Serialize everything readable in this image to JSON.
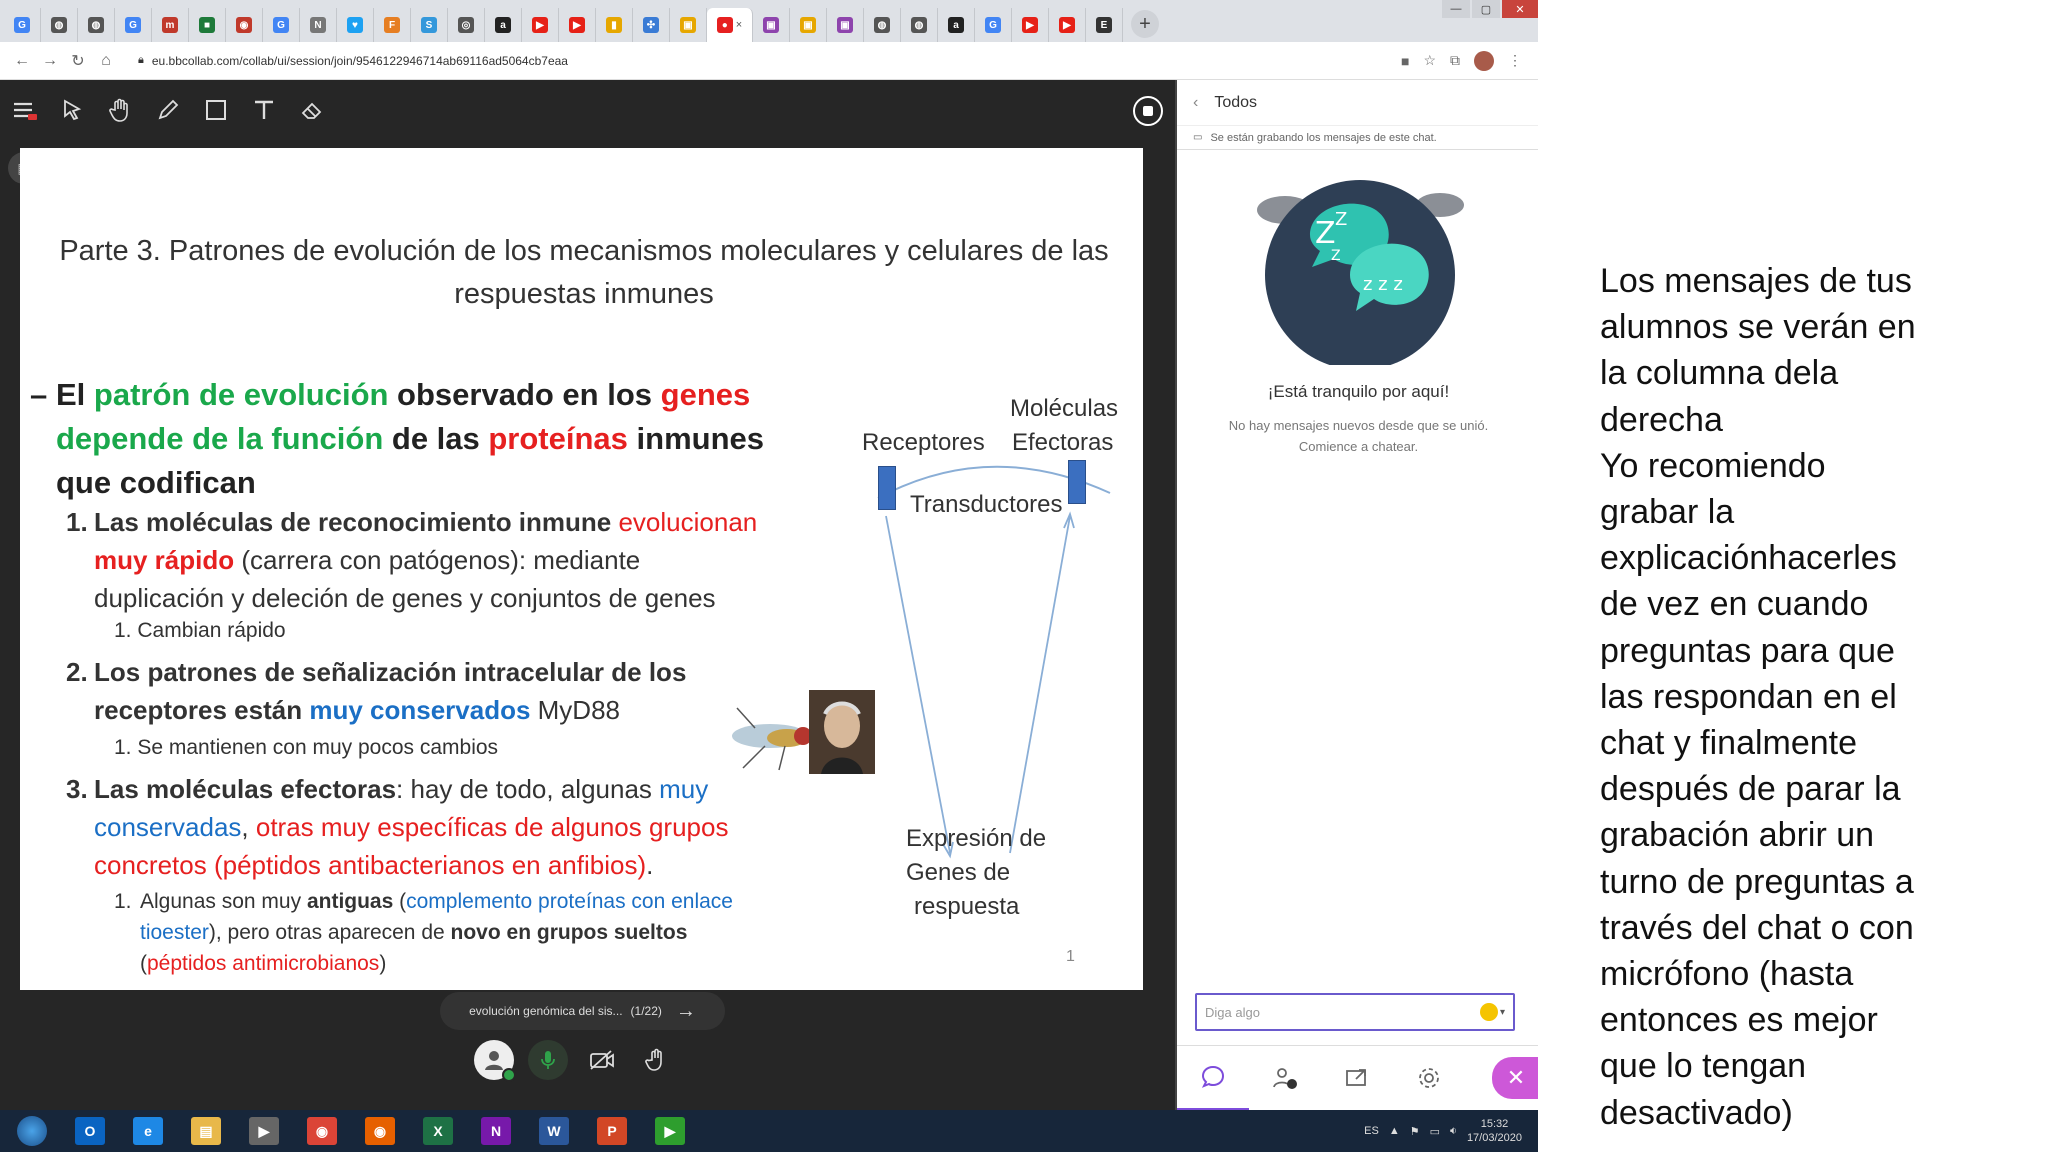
{
  "browser": {
    "tabs": [
      {
        "icon": "G",
        "color": "#4285f4"
      },
      {
        "icon": "◍",
        "color": "#555"
      },
      {
        "icon": "◍",
        "color": "#555"
      },
      {
        "icon": "G",
        "color": "#4285f4"
      },
      {
        "icon": "m",
        "color": "#c0392b"
      },
      {
        "icon": "■",
        "color": "#1e7a3a"
      },
      {
        "icon": "◉",
        "color": "#c0392b"
      },
      {
        "icon": "G",
        "color": "#4285f4"
      },
      {
        "icon": "N",
        "color": "#777"
      },
      {
        "icon": "♥",
        "color": "#1da1f2"
      },
      {
        "icon": "F",
        "color": "#e67e22"
      },
      {
        "icon": "S",
        "color": "#3498db"
      },
      {
        "icon": "◎",
        "color": "#555"
      },
      {
        "icon": "a",
        "color": "#222"
      },
      {
        "icon": "▶",
        "color": "#e62117"
      },
      {
        "icon": "▶",
        "color": "#e62117"
      },
      {
        "icon": "▮",
        "color": "#e6a700"
      },
      {
        "icon": "✣",
        "color": "#3a7bd5"
      },
      {
        "icon": "▣",
        "color": "#e6a700"
      },
      {
        "icon": "●",
        "color": "#e62020"
      },
      {
        "icon": "▣",
        "color": "#8e44ad"
      },
      {
        "icon": "▣",
        "color": "#e6a700"
      },
      {
        "icon": "▣",
        "color": "#8e44ad"
      },
      {
        "icon": "◍",
        "color": "#555"
      },
      {
        "icon": "◍",
        "color": "#555"
      },
      {
        "icon": "a",
        "color": "#222"
      },
      {
        "icon": "G",
        "color": "#4285f4"
      },
      {
        "icon": "▶",
        "color": "#e62117"
      },
      {
        "icon": "▶",
        "color": "#e62117"
      },
      {
        "icon": "E",
        "color": "#333"
      }
    ],
    "active_tab_index": 19,
    "url": "eu.bbcollab.com/collab/ui/session/join/9546122946714ab69116ad5064cb7eaa"
  },
  "slide": {
    "title": "Parte 3. Patrones de evolución de los mecanismos moleculares y celulares de las respuestas inmunes",
    "bullet": {
      "dash": "–",
      "p1": "El ",
      "p2": "patrón de evolución",
      "p3": " observado en los ",
      "p4": "genes",
      "p5": "depende de la función",
      "p6": " de las ",
      "p7": "proteínas",
      "p8": " inmunes",
      "p9": "que codifican"
    },
    "item1": {
      "num": "1.",
      "a": "Las moléculas  de reconocimiento inmune ",
      "b": "evolucionan",
      "c": "muy rápido",
      "d": " (carrera con patógenos): mediante",
      "e": "duplicación y  deleción de genes y conjuntos de genes",
      "sub_num": "1.",
      "sub": "Cambian rápido"
    },
    "item2": {
      "num": "2.",
      "a": "Los patrones de señalización intracelular de los",
      "b": "receptores están ",
      "c": "muy conservados",
      "d": "  MyD88",
      "sub_num": "1.",
      "sub": "Se mantienen con muy pocos cambios"
    },
    "item3": {
      "num": "3.",
      "a": "Las moléculas efectoras",
      "b": ": hay de todo, algunas ",
      "c": "muy",
      "d": "conservadas",
      "e": ",  ",
      "f": "otras muy específicas  de algunos grupos",
      "g": "concretos (péptidos antibacterianos en anfibios)",
      "h": ".",
      "sub_num": "1.",
      "s1": "Algunas son muy ",
      "s2": "antiguas",
      "s3": "  (",
      "s4": "complemento proteínas con enlace",
      "s5": "tioester",
      "s6": "), pero otras aparecen de ",
      "s7": "novo en grupos sueltos",
      "s8": "(",
      "s9": "péptidos antimicrobianos",
      "s10": ")"
    },
    "diagram": {
      "receptores": "Receptores",
      "moleculas": "Moléculas",
      "efectoras": "Efectoras",
      "transductores": "Transductores",
      "expresion1": "Expresión de",
      "expresion2": "Genes de",
      "expresion3": "respuesta"
    },
    "page_number": "1"
  },
  "presentation": {
    "file_label": "evolución genómica del sis...",
    "page": "(1/22)"
  },
  "chat": {
    "title": "Todos",
    "recording_notice": "Se están grabando los mensajes de este chat.",
    "quiet": "¡Está tranquilo por aquí!",
    "no_messages": "No hay mensajes nuevos desde que se unió. Comience a chatear.",
    "placeholder": "Diga algo"
  },
  "taskbar": {
    "apps": [
      {
        "label": "O",
        "color": "#0a64c2"
      },
      {
        "label": "e",
        "color": "#1e88e5"
      },
      {
        "label": "▤",
        "color": "#e8b84a"
      },
      {
        "label": "▶",
        "color": "#666"
      },
      {
        "label": "◉",
        "color": "#db4437"
      },
      {
        "label": "◉",
        "color": "#e66000"
      },
      {
        "label": "X",
        "color": "#1e7145"
      },
      {
        "label": "N",
        "color": "#7719aa"
      },
      {
        "label": "W",
        "color": "#2b579a"
      },
      {
        "label": "P",
        "color": "#d24726"
      },
      {
        "label": "▶",
        "color": "#2e9e2e"
      }
    ],
    "lang": "ES",
    "time": "15:32",
    "date": "17/03/2020"
  },
  "notes": "Los mensajes de tus\nalumnos se verán en\nla columna dela\nderecha\nYo recomiendo\ngrabar la\nexplicaciónhacerles\nde vez en cuando\npreguntas para que\nlas respondan en el\nchat y finalmente\ndespués de parar la\ngrabación  abrir un\nturno de preguntas a\ntravés del chat  o con\nmicrófono (hasta\nentonces es mejor\nque lo tengan\ndesactivado)"
}
